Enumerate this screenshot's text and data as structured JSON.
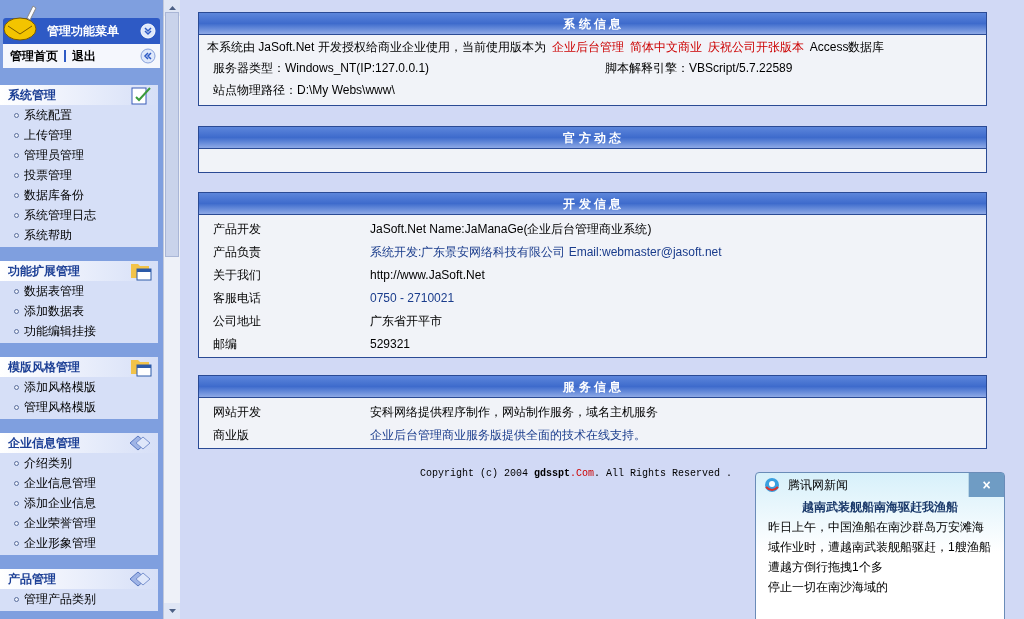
{
  "sidebar": {
    "title": "管理功能菜单",
    "nav_links": [
      "管理首页",
      "退出"
    ],
    "sections": [
      {
        "title": "系统管理",
        "items": [
          "系统配置",
          "上传管理",
          "管理员管理",
          "投票管理",
          "数据库备份",
          "系统管理日志",
          "系统帮助"
        ]
      },
      {
        "title": "功能扩展管理",
        "items": [
          "数据表管理",
          "添加数据表",
          "功能编辑挂接"
        ]
      },
      {
        "title": "模版风格管理",
        "items": [
          "添加风格模版",
          "管理风格模版"
        ]
      },
      {
        "title": "企业信息管理",
        "items": [
          "介绍类别",
          "企业信息管理",
          "添加企业信息",
          "企业荣誉管理",
          "企业形象管理"
        ]
      },
      {
        "title": "产品管理",
        "items": [
          "管理产品类别"
        ]
      }
    ]
  },
  "system_info": {
    "title": "系 统 信 息",
    "intro": [
      {
        "kind": "plain",
        "text": "本系统由 JaSoft.Net 开发授权给商业企业使用，当前使用版本为"
      },
      {
        "kind": "highlight",
        "text": "企业后台管理"
      },
      {
        "kind": "highlight",
        "text": "简体中文商业"
      },
      {
        "kind": "highlight",
        "text": "庆祝公司开张版本"
      },
      {
        "kind": "plain",
        "text": "Access数据库"
      }
    ],
    "server_type": "服务器类型：Windows_NT(IP:127.0.0.1)",
    "script_engine": "脚本解释引擎：VBScript/5.7.22589",
    "path": "站点物理路径：D:\\My Webs\\www\\"
  },
  "official_news": {
    "title": "官 方 动 态"
  },
  "dev_info": {
    "title": "开 发 信 息",
    "rows": [
      {
        "label": "产品开发",
        "value": "JaSoft.Net Name:JaManaGe(企业后台管理商业系统)",
        "kind": "plain"
      },
      {
        "label": "产品负责",
        "value": "系统开发:广东景安网络科技有限公司 Email:webmaster@jasoft.net",
        "kind": "link"
      },
      {
        "label": "关于我们",
        "value": "http://www.JaSoft.Net",
        "kind": "plain"
      },
      {
        "label": "客服电话",
        "value": "0750 - 2710021",
        "kind": "link"
      },
      {
        "label": "公司地址",
        "value": "广东省开平市",
        "kind": "plain"
      },
      {
        "label": "邮编",
        "value": "529321",
        "kind": "plain"
      }
    ]
  },
  "service_info": {
    "title": "服 务 信 息",
    "rows": [
      {
        "label": "网站开发",
        "value": "安科网络提供程序制作，网站制作服务，域名主机服务",
        "kind": "plain"
      },
      {
        "label": "商业版",
        "value": "企业后台管理商业服务版提供全面的技术在线支持。",
        "kind": "link"
      }
    ]
  },
  "footer": [
    {
      "kind": "plain",
      "text": "Copyright (c) 2004"
    },
    {
      "kind": "bold",
      "text": "gdsspt"
    },
    {
      "kind": "highlight",
      "text": ".Com"
    },
    {
      "kind": "plain",
      "text": ". All Rights Reserved ."
    }
  ],
  "news_popup": {
    "source": "腾讯网新闻",
    "close": "×",
    "headline": "越南武装舰船南海驱赶我渔船",
    "lines": [
      "昨日上午，中国渔船在南沙群岛万安滩海",
      "域作业时，遭越南武装舰船驱赶，1艘渔船",
      "遭越方倒行拖拽1个多",
      "停止一切在南沙海域的"
    ]
  }
}
